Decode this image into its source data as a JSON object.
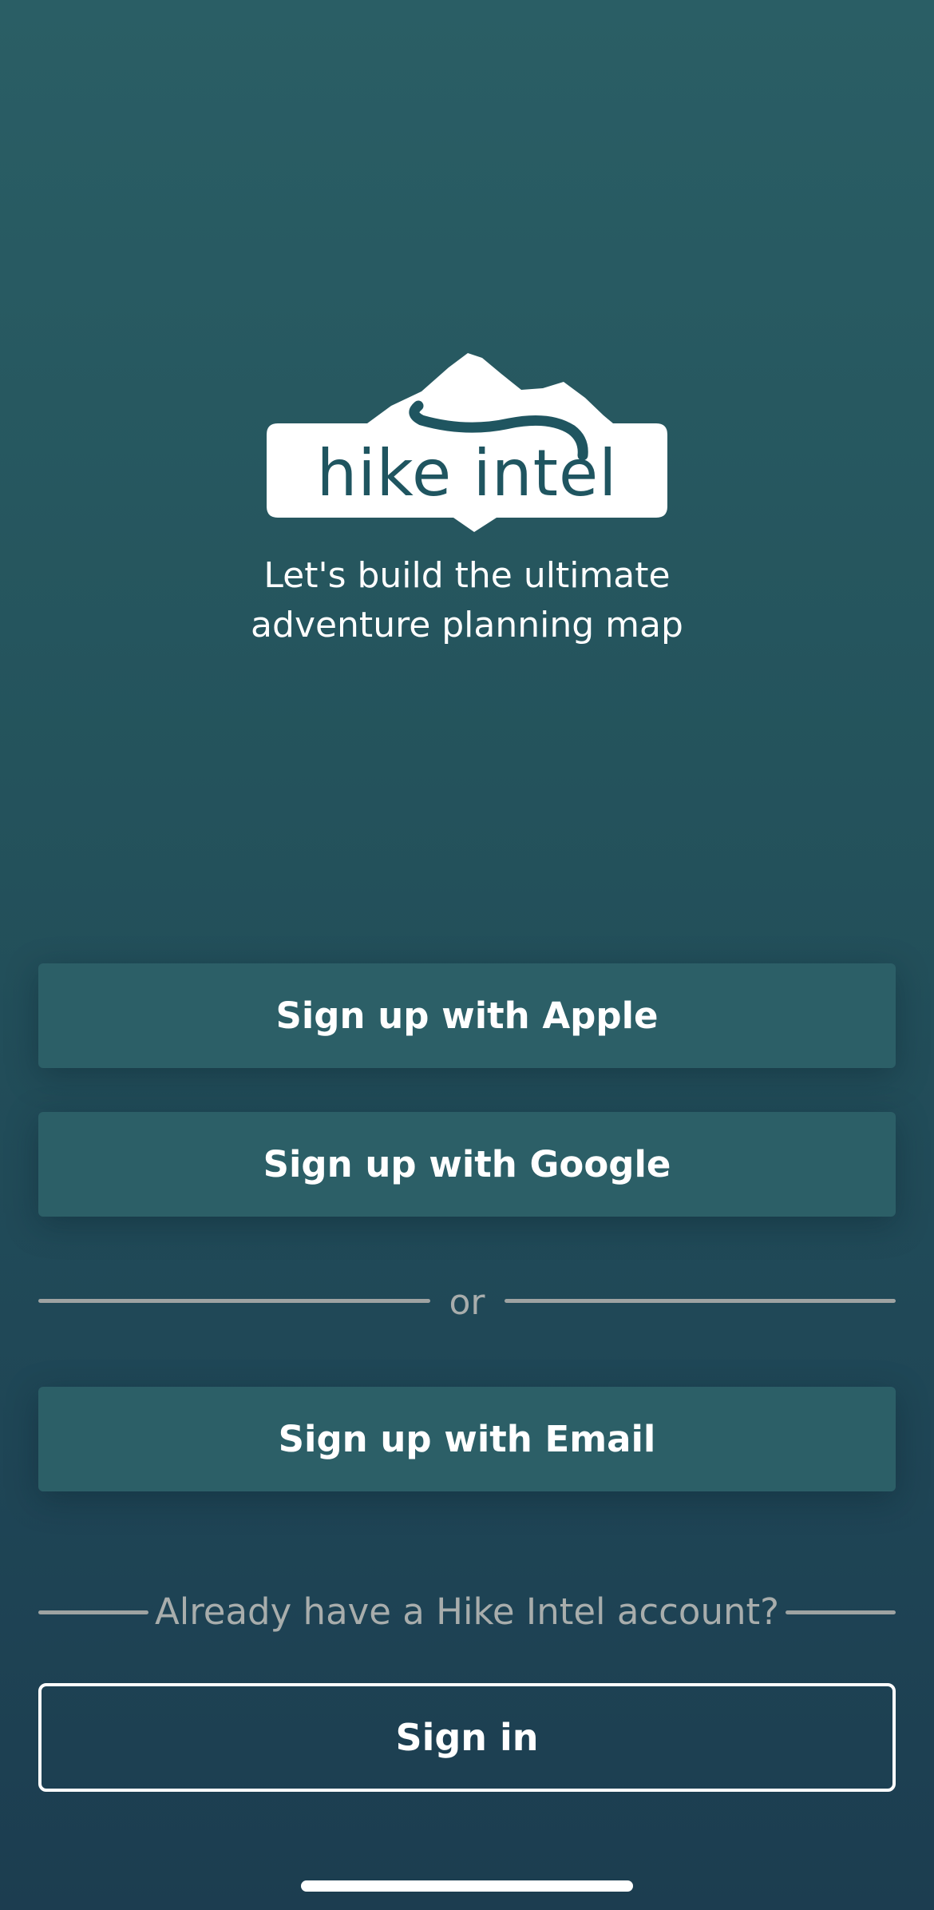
{
  "logo": {
    "text": "hike intel"
  },
  "tagline": {
    "line1": "Let's build the ultimate",
    "line2": "adventure planning map"
  },
  "buttons": {
    "apple": "Sign up with Apple",
    "google": "Sign up with Google",
    "email": "Sign up with Email",
    "signin": "Sign in"
  },
  "divider": {
    "or": "or"
  },
  "existing_account": {
    "prompt": "Already have a Hike Intel account?"
  },
  "colors": {
    "background_top": "#2a5e65",
    "background_bottom": "#1c3d50",
    "button_fill": "#2c5f67",
    "divider": "#9ea3a2",
    "muted_text": "#a8adac",
    "logo_ink": "#1f5560"
  }
}
